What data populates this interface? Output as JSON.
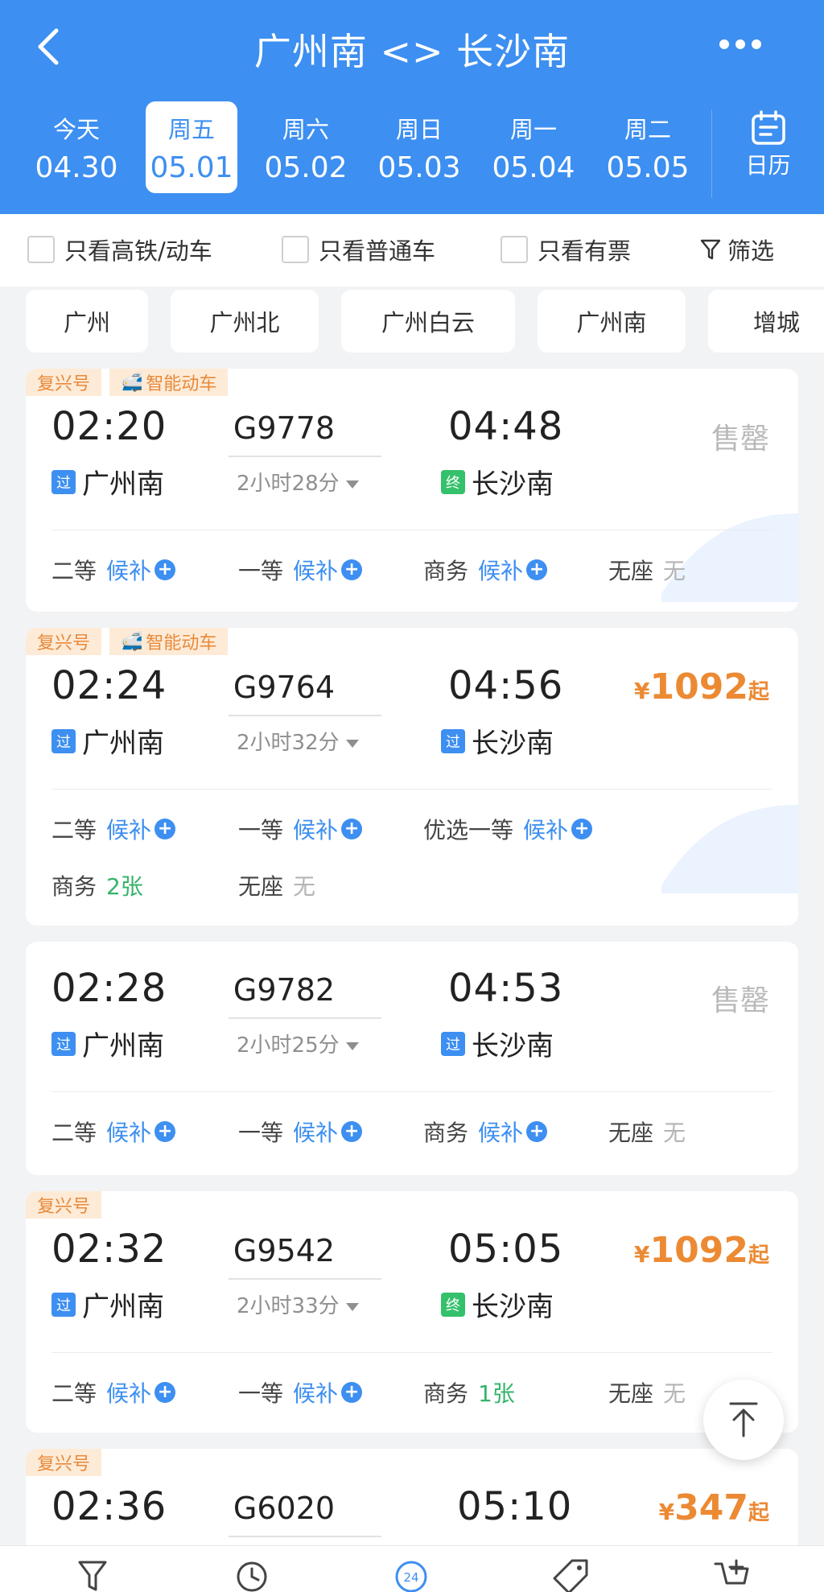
{
  "header": {
    "title": "广州南 <> 长沙南",
    "dates": [
      {
        "weekday": "今天",
        "date": "04.30"
      },
      {
        "weekday": "周五",
        "date": "05.01"
      },
      {
        "weekday": "周六",
        "date": "05.02"
      },
      {
        "weekday": "周日",
        "date": "05.03"
      },
      {
        "weekday": "周一",
        "date": "05.04"
      },
      {
        "weekday": "周二",
        "date": "05.05"
      }
    ],
    "calendar_label": "日历"
  },
  "filters": {
    "high_speed_only": "只看高铁/动车",
    "normal_only": "只看普通车",
    "available_only": "只看有票",
    "screen": "筛选"
  },
  "stations": [
    "广州",
    "广州北",
    "广州白云",
    "广州南",
    "增城"
  ],
  "trains": [
    {
      "badges": [
        "复兴号",
        "智能动车"
      ],
      "dep_time": "02:20",
      "train_no": "G9778",
      "arr_time": "04:48",
      "duration": "2小时28分",
      "dep_tag": "过",
      "dep_station": "广州南",
      "arr_tag": "终",
      "arr_station": "长沙南",
      "status": "售罄",
      "seats": [
        {
          "name": "二等",
          "value": "候补"
        },
        {
          "name": "一等",
          "value": "候补"
        },
        {
          "name": "商务",
          "value": "候补"
        },
        {
          "name": "无座",
          "value": "无"
        }
      ]
    },
    {
      "badges": [
        "复兴号",
        "智能动车"
      ],
      "dep_time": "02:24",
      "train_no": "G9764",
      "arr_time": "04:56",
      "duration": "2小时32分",
      "dep_tag": "过",
      "dep_station": "广州南",
      "arr_tag": "过",
      "arr_station": "长沙南",
      "price": {
        "currency": "¥",
        "amount": "1092",
        "suffix": "起"
      },
      "seats": [
        {
          "name": "二等",
          "value": "候补"
        },
        {
          "name": "一等",
          "value": "候补"
        },
        {
          "name": "优选一等",
          "value": "候补"
        },
        {
          "name": "商务",
          "value": "2张"
        },
        {
          "name": "无座",
          "value": "无"
        }
      ]
    },
    {
      "dep_time": "02:28",
      "train_no": "G9782",
      "arr_time": "04:53",
      "duration": "2小时25分",
      "dep_tag": "过",
      "dep_station": "广州南",
      "arr_tag": "过",
      "arr_station": "长沙南",
      "status": "售罄",
      "seats": [
        {
          "name": "二等",
          "value": "候补"
        },
        {
          "name": "一等",
          "value": "候补"
        },
        {
          "name": "商务",
          "value": "候补"
        },
        {
          "name": "无座",
          "value": "无"
        }
      ]
    },
    {
      "badges": [
        "复兴号"
      ],
      "dep_time": "02:32",
      "train_no": "G9542",
      "arr_time": "05:05",
      "duration": "2小时33分",
      "dep_tag": "过",
      "dep_station": "广州南",
      "arr_tag": "终",
      "arr_station": "长沙南",
      "price": {
        "currency": "¥",
        "amount": "1092",
        "suffix": "起"
      },
      "seats": [
        {
          "name": "二等",
          "value": "候补"
        },
        {
          "name": "一等",
          "value": "候补"
        },
        {
          "name": "商务",
          "value": "1张"
        },
        {
          "name": "无座",
          "value": "无"
        }
      ]
    },
    {
      "badges": [
        "复兴号"
      ],
      "dep_time": "02:36",
      "train_no": "G6020",
      "arr_time": "05:10",
      "price": {
        "currency": "¥",
        "amount": "347",
        "suffix": "起"
      }
    }
  ],
  "colors": {
    "brand": "#3d8ff1",
    "price": "#ec8a34",
    "available": "#35b36a",
    "sold_out": "#b9b9b9"
  },
  "bottom_nav_icons": [
    "filter-icon",
    "clock-icon",
    "24h-icon",
    "tag-icon",
    "cart-icon"
  ]
}
